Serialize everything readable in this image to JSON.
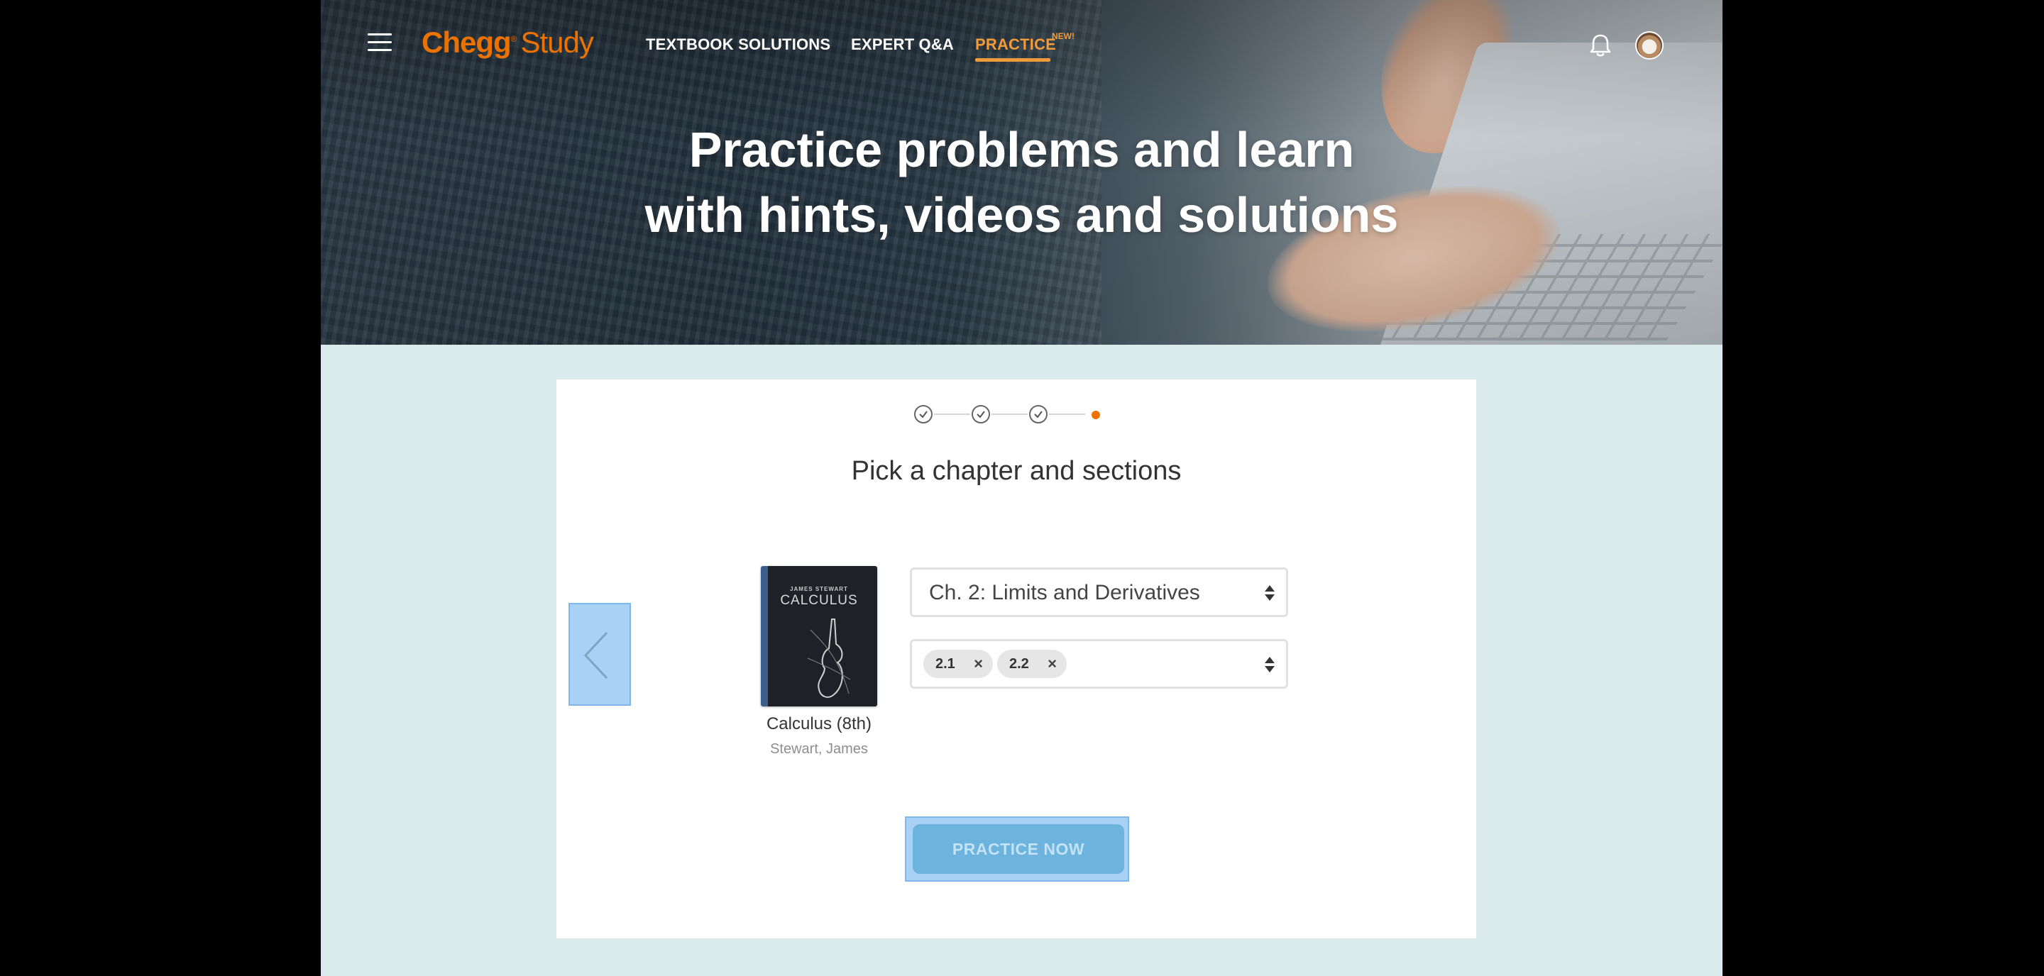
{
  "header": {
    "logo_brand": "Chegg",
    "logo_reg": "®",
    "logo_product": "Study",
    "nav": {
      "textbook_solutions": "TEXTBOOK SOLUTIONS",
      "expert_qa": "EXPERT Q&A",
      "practice": "PRACTICE",
      "practice_badge": "NEW!"
    },
    "icons": {
      "menu": "hamburger-menu-icon",
      "notifications": "bell-icon",
      "profile": "avatar"
    }
  },
  "hero": {
    "title_line1": "Practice problems and learn",
    "title_line2": "with hints, videos and solutions"
  },
  "wizard": {
    "steps": [
      {
        "state": "complete"
      },
      {
        "state": "complete"
      },
      {
        "state": "complete"
      },
      {
        "state": "current"
      }
    ],
    "title": "Pick a chapter and sections",
    "book": {
      "cover_author": "JAMES STEWART",
      "cover_title": "CALCULUS",
      "title": "Calculus (8th)",
      "author": "Stewart, James"
    },
    "chapter_select": {
      "value": "Ch. 2: Limits and Derivatives"
    },
    "section_select": {
      "chips": [
        {
          "label": "2.1",
          "remove": "×"
        },
        {
          "label": "2.2",
          "remove": "×"
        }
      ]
    },
    "practice_button": "PRACTICE NOW"
  },
  "colors": {
    "brand_orange": "#eb7100",
    "nav_active": "#f39a3b",
    "page_background": "#dbeaea",
    "button_disabled": "#6cb3de",
    "highlight": "#a9d0f5"
  }
}
